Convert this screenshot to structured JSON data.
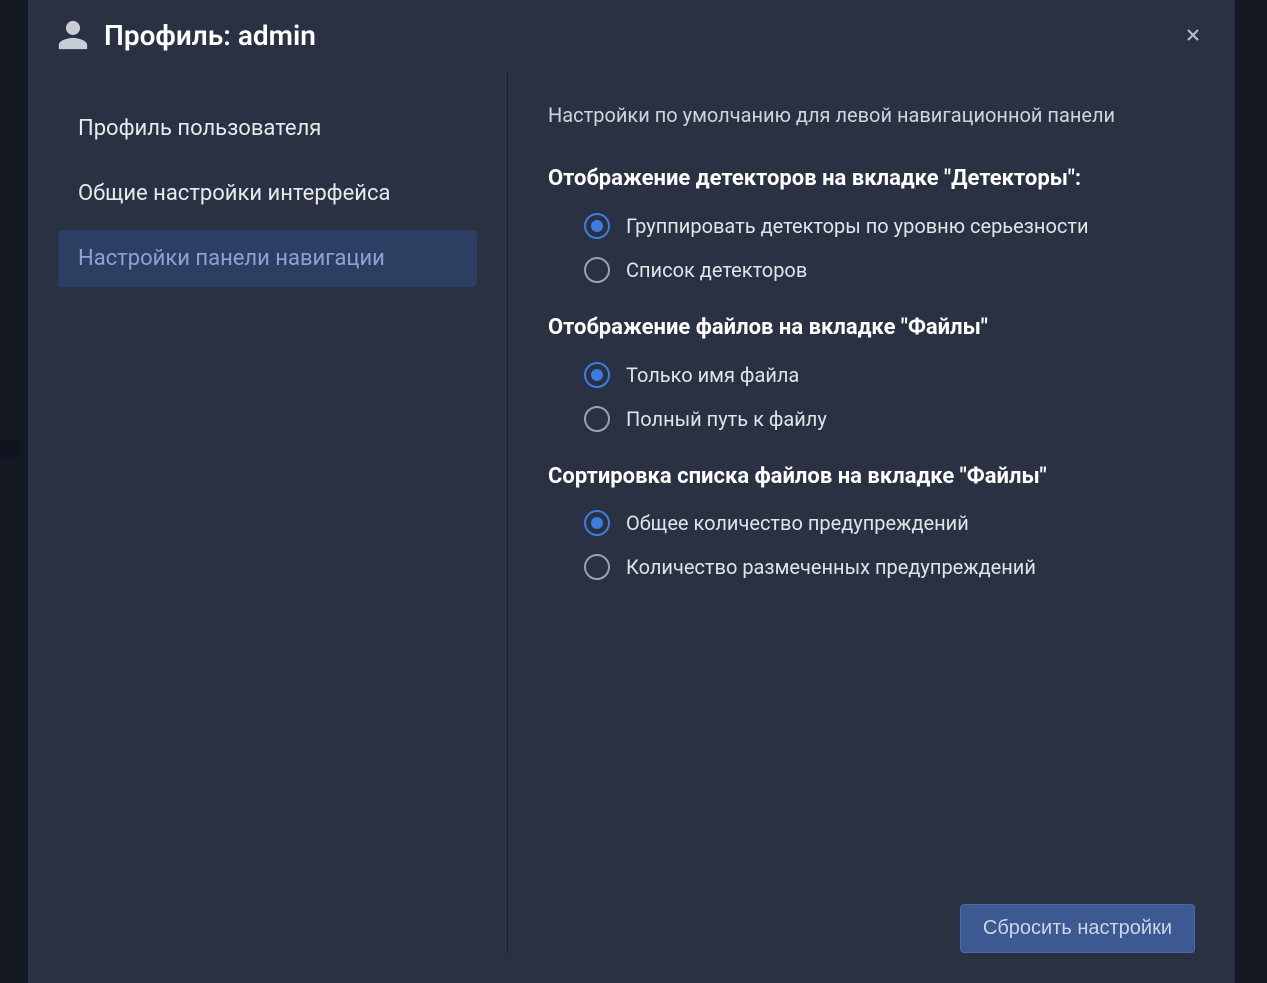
{
  "header": {
    "title": "Профиль: admin"
  },
  "sidebar": {
    "items": [
      {
        "label": "Профиль пользователя"
      },
      {
        "label": "Общие настройки интерфейса"
      },
      {
        "label": "Настройки панели навигации"
      }
    ]
  },
  "content": {
    "description": "Настройки по умолчанию для левой навигационной панели",
    "sections": [
      {
        "title": "Отображение детекторов на вкладке \"Детекторы\":",
        "options": [
          {
            "label": "Группировать детекторы по уровню серьезности"
          },
          {
            "label": "Список детекторов"
          }
        ]
      },
      {
        "title": "Отображение файлов на вкладке \"Файлы\"",
        "options": [
          {
            "label": "Только имя файла"
          },
          {
            "label": "Полный путь к файлу"
          }
        ]
      },
      {
        "title": "Сортировка списка файлов на вкладке \"Файлы\"",
        "options": [
          {
            "label": "Общее количество предупреждений"
          },
          {
            "label": "Количество размеченных предупреждений"
          }
        ]
      }
    ],
    "reset_button": "Сбросить настройки"
  }
}
